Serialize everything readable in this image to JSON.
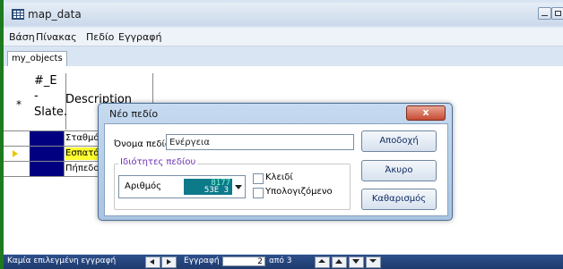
{
  "window": {
    "title": "map_data"
  },
  "menubar": {
    "items": [
      "Βάση",
      "Πίνακας",
      "Πεδίο",
      "Εγγραφή"
    ]
  },
  "tabs": [
    "my_objects"
  ],
  "grid": {
    "header": {
      "row_marker": "*",
      "col1_lines": [
        "#_E",
        "-",
        "Slate."
      ],
      "col2": "Description"
    },
    "rows": [
      {
        "text": "Σταθμός"
      },
      {
        "text": "Εσπατόρι"
      },
      {
        "text": "Πήπεδο"
      }
    ]
  },
  "dialog": {
    "title": "Νέο πεδίο",
    "close_label": "x",
    "field_name_label": "Όνομα πεδίου",
    "field_name_value": "Ενέργεια",
    "properties_legend": "Ιδιότητες πεδίου",
    "type_value": "Αριθμός",
    "type_graphic_top": "8177",
    "type_graphic_bottom": "53E 3",
    "key_label": "Κλειδί",
    "computed_label": "Υπολογιζόμενο",
    "ok_label": "Αποδοχή",
    "cancel_label": "Άκυρο",
    "clear_label": "Καθαρισμός"
  },
  "statusbar": {
    "selection_text": "Καμία επιλεγμένη εγγραφή",
    "record_label": "Εγγραφή",
    "record_value": "2",
    "record_total": "από 3"
  },
  "colors": {
    "accent_green": "#1e7a1e",
    "status_bar": "#1f3b6d",
    "selected_row": "#ffff33",
    "id_cell": "#000080"
  }
}
